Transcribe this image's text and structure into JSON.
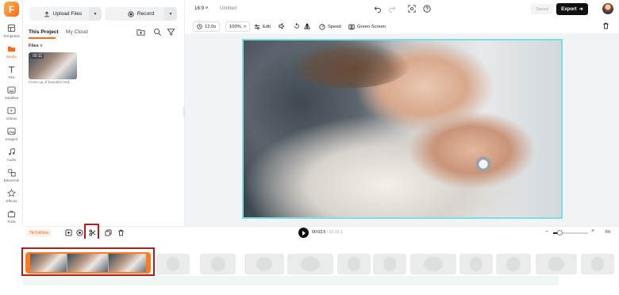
{
  "app": {
    "logo_letter": "F",
    "brand_color": "#ff6a1a"
  },
  "rail": {
    "items": [
      {
        "label": "Templates",
        "icon": "templates-icon"
      },
      {
        "label": "Media",
        "icon": "media-icon",
        "active": true
      },
      {
        "label": "Text",
        "icon": "text-icon"
      },
      {
        "label": "Subtitles",
        "icon": "subtitles-icon"
      },
      {
        "label": "Videos",
        "icon": "videos-icon"
      },
      {
        "label": "Images",
        "icon": "images-icon"
      },
      {
        "label": "Audio",
        "icon": "audio-icon"
      },
      {
        "label": "Elements",
        "icon": "elements-icon"
      },
      {
        "label": "Effects",
        "icon": "effects-icon"
      },
      {
        "label": "Tools",
        "icon": "tools-icon"
      }
    ]
  },
  "panel": {
    "upload_label": "Upload Files",
    "record_label": "Record",
    "tabs": [
      "This Project",
      "My Cloud"
    ],
    "files_label": "Files",
    "media": {
      "duration": "00:11",
      "caption": "Close-up of beautiful brid..."
    }
  },
  "topbar": {
    "ratio": "16:9",
    "title": "Untitled",
    "saved_label": "Saved",
    "export_label": "Export"
  },
  "toolbar": {
    "duration": "12.0s",
    "zoom": "100%",
    "edit_label": "Edit",
    "speed_label": "Speed",
    "green_screen_label": "Green Screen"
  },
  "timeline": {
    "track_chip": "TikTokNow",
    "tooltip": "Trim",
    "current_time": "00:03.5",
    "total_time": "/ 01:02.1",
    "fit_label": "Fit",
    "zoom_level": 0.2
  }
}
